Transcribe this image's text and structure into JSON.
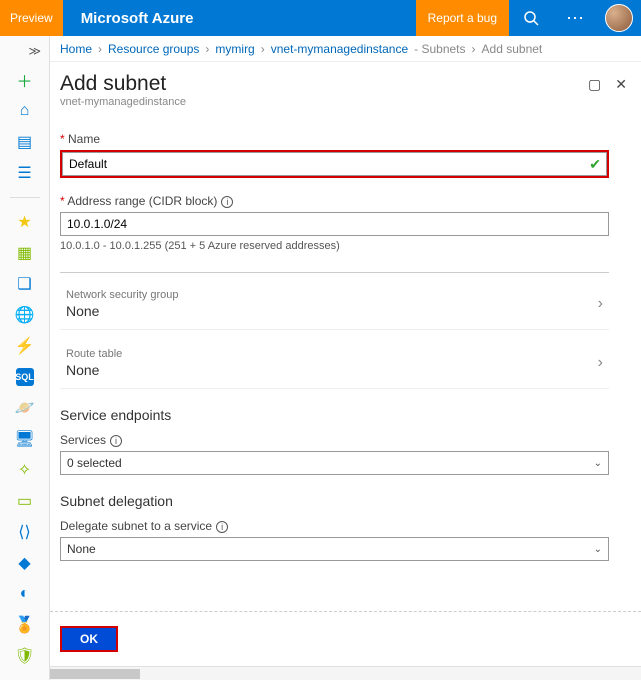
{
  "topbar": {
    "preview": "Preview",
    "brand": "Microsoft Azure",
    "bug": "Report a bug"
  },
  "crumbs": {
    "home": "Home",
    "rg": "Resource groups",
    "rgname": "mymirg",
    "vnet": "vnet-mymanagedinstance",
    "subnets": "- Subnets",
    "leaf": "Add subnet"
  },
  "blade": {
    "title": "Add subnet",
    "subtitle": "vnet-mymanagedinstance"
  },
  "form": {
    "name_label": "Name",
    "name_value": "Default",
    "addr_label": "Address range (CIDR block)",
    "addr_value": "10.0.1.0/24",
    "addr_hint": "10.0.1.0 - 10.0.1.255 (251 + 5 Azure reserved addresses)",
    "nsg_label": "Network security group",
    "nsg_value": "None",
    "rt_label": "Route table",
    "rt_value": "None",
    "se_head": "Service endpoints",
    "se_label": "Services",
    "se_value": "0 selected",
    "sd_head": "Subnet delegation",
    "sd_label": "Delegate subnet to a service",
    "sd_value": "None",
    "ok": "OK"
  }
}
